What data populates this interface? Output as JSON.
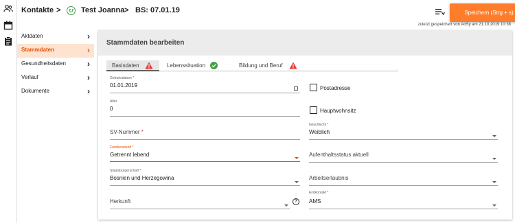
{
  "header": {
    "section": "Kontakte",
    "person": "Test Joanna",
    "record": "BS: 07.01.19",
    "save_label": "Speichern (Strg + s)",
    "saved_info": "zuletzt gespeichert von AdSy am 21.10.2019 10:38"
  },
  "rail": {
    "icons": [
      "contacts-icon",
      "calendar-icon",
      "clipboard-icon"
    ]
  },
  "nav": {
    "items": [
      {
        "label": "Aktdaten",
        "active": false
      },
      {
        "label": "Stammdaten",
        "active": true
      },
      {
        "label": "Gesundheitsdaten",
        "active": false
      },
      {
        "label": "Verlauf",
        "active": false
      },
      {
        "label": "Dokumente",
        "active": false
      }
    ]
  },
  "panel": {
    "title": "Stammdaten bearbeiten"
  },
  "tabs": [
    {
      "label": "Basisdaten",
      "status": "warning"
    },
    {
      "label": "Lebenssituation",
      "status": "ok"
    },
    {
      "label": "Bildung und Beruf",
      "status": "warning"
    }
  ],
  "form": {
    "geburtsdatum": {
      "label": "Geburtsdatum *",
      "value": "01.01.2019"
    },
    "alter": {
      "label": "Alter",
      "value": "0"
    },
    "sv": {
      "placeholder": "SV-Nummer",
      "star": "*"
    },
    "familienstand": {
      "label": "Familienstand *",
      "value": "Getrennt lebend"
    },
    "staatsbuergerschaft": {
      "label": "Staatsbürgerschaft *",
      "value": "Bosnien und Herzegowina"
    },
    "herkunft": {
      "placeholder": "Herkunft"
    },
    "postadresse": {
      "label": "Postadresse",
      "checked": false
    },
    "hauptwohnsitz": {
      "label": "Hauptwohnsitz",
      "checked": false
    },
    "geschlecht": {
      "label": "Geschlecht *",
      "value": "Weiblich"
    },
    "aufenthalt": {
      "placeholder": "Aufenthaltsstatus aktuell"
    },
    "arbeit": {
      "placeholder": "Arbeitserlaubnis"
    },
    "erstkontakt": {
      "label": "Erstkontakt *",
      "value": "AMS"
    }
  },
  "colors": {
    "accent": "#ff7d2a",
    "active_text": "#e65100",
    "active_bg": "#fde3d0",
    "warning": "#e53935",
    "ok": "#43a047"
  }
}
